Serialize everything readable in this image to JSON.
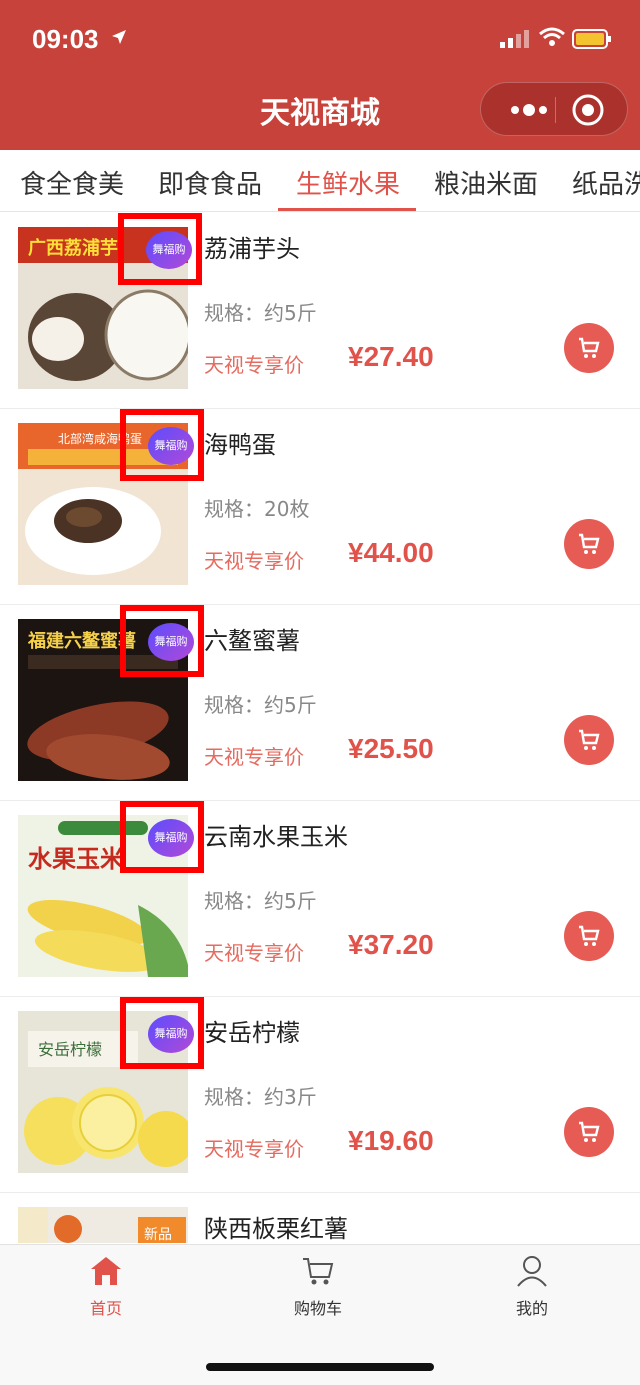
{
  "status": {
    "time": "09:03"
  },
  "header": {
    "title": "天视商城"
  },
  "tabs": [
    "食全食美",
    "即食食品",
    "生鲜水果",
    "粮油米面",
    "纸品洗"
  ],
  "active_tab": 2,
  "products": [
    {
      "name": "荔浦芋头",
      "spec": "规格：约5斤",
      "price_tag": "天视专享价",
      "price": "¥27.40",
      "badge": "舞福购",
      "img_text": "广西荔浦芋"
    },
    {
      "name": "海鸭蛋",
      "spec": "规格：20枚",
      "price_tag": "天视专享价",
      "price": "¥44.00",
      "badge": "舞福购",
      "img_text": "北部湾咸海鸭蛋"
    },
    {
      "name": "六鳌蜜薯",
      "spec": "规格：约5斤",
      "price_tag": "天视专享价",
      "price": "¥25.50",
      "badge": "舞福购",
      "img_text": "福建六鳌蜜薯"
    },
    {
      "name": "云南水果玉米",
      "spec": "规格：约5斤",
      "price_tag": "天视专享价",
      "price": "¥37.20",
      "badge": "舞福购",
      "img_text": "水果玉米"
    },
    {
      "name": "安岳柠檬",
      "spec": "规格：约3斤",
      "price_tag": "天视专享价",
      "price": "¥19.60",
      "badge": "舞福购",
      "img_text": "安岳柠檬"
    },
    {
      "name": "陕西板栗红薯",
      "img_text": "新品"
    }
  ],
  "bottom_nav": [
    {
      "label": "首页",
      "icon": "home-icon"
    },
    {
      "label": "购物车",
      "icon": "cart-icon"
    },
    {
      "label": "我的",
      "icon": "user-icon"
    }
  ],
  "colors": {
    "header": "#c7423a",
    "accent": "#e0524a",
    "badge_outline": "#ff0000"
  }
}
